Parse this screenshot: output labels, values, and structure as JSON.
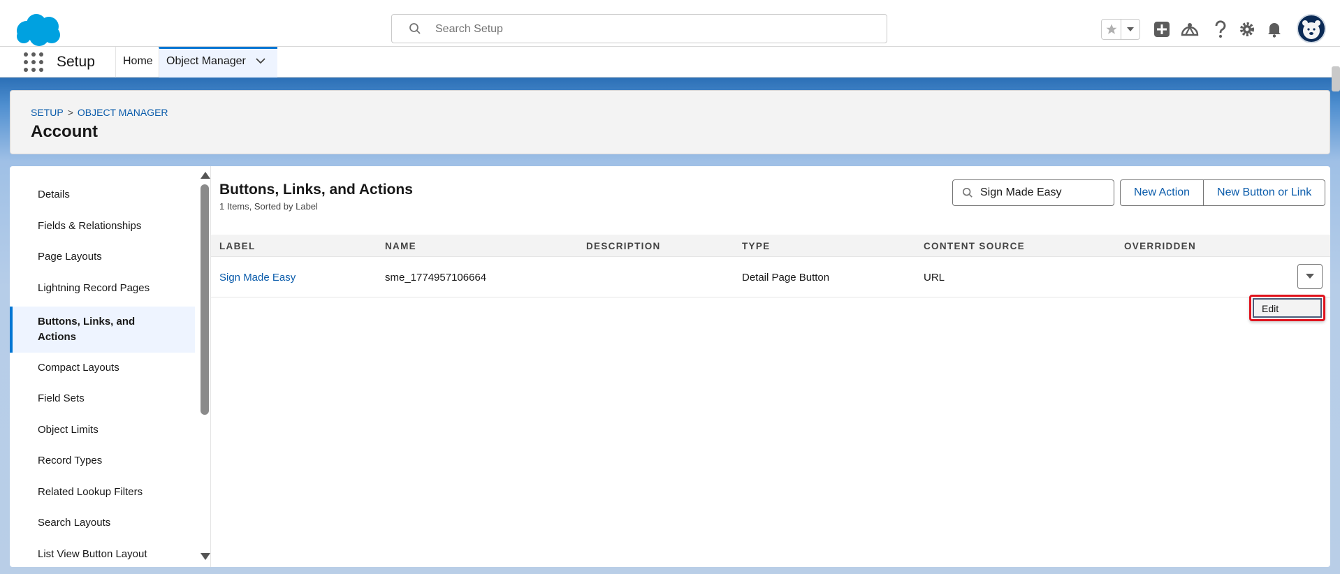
{
  "header": {
    "search_placeholder": "Search Setup"
  },
  "context_bar": {
    "app_name": "Setup",
    "tabs": [
      {
        "label": "Home"
      },
      {
        "label": "Object Manager"
      }
    ]
  },
  "page_header": {
    "breadcrumb": [
      "SETUP",
      "OBJECT MANAGER"
    ],
    "breadcrumb_separator": ">",
    "title": "Account"
  },
  "left_nav": {
    "items": [
      {
        "label": "Details"
      },
      {
        "label": "Fields & Relationships"
      },
      {
        "label": "Page Layouts"
      },
      {
        "label": "Lightning Record Pages"
      },
      {
        "label": "Buttons, Links, and Actions"
      },
      {
        "label": "Compact Layouts"
      },
      {
        "label": "Field Sets"
      },
      {
        "label": "Object Limits"
      },
      {
        "label": "Record Types"
      },
      {
        "label": "Related Lookup Filters"
      },
      {
        "label": "Search Layouts"
      },
      {
        "label": "List View Button Layout"
      }
    ],
    "selected_index": 4
  },
  "section": {
    "title": "Buttons, Links, and Actions",
    "subtitle": "1 Items, Sorted by Label",
    "quick_find_value": "Sign Made Easy",
    "new_action_label": "New Action",
    "new_button_label": "New Button or Link"
  },
  "table": {
    "columns": [
      "LABEL",
      "NAME",
      "DESCRIPTION",
      "TYPE",
      "CONTENT SOURCE",
      "OVERRIDDEN"
    ],
    "rows": [
      {
        "label": "Sign Made Easy",
        "name": "sme_1774957106664",
        "description": "",
        "type": "Detail Page Button",
        "content_source": "URL",
        "overridden": ""
      }
    ]
  },
  "row_menu": {
    "items": [
      {
        "label": "Edit"
      }
    ]
  },
  "colors": {
    "brand_blue": "#0176d3",
    "link_blue": "#0b5cab",
    "highlight_red": "#e0141e",
    "logo_blue": "#00a1e0"
  }
}
